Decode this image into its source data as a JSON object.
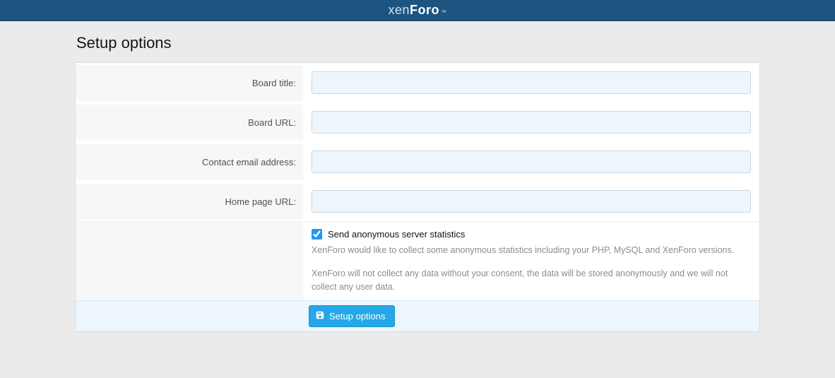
{
  "brand": {
    "part1": "xen",
    "part2": "Foro",
    "tm": "™"
  },
  "page": {
    "title": "Setup options"
  },
  "form": {
    "board_title": {
      "label": "Board title:",
      "value": ""
    },
    "board_url": {
      "label": "Board URL:",
      "value": ""
    },
    "contact_email": {
      "label": "Contact email address:",
      "value": ""
    },
    "home_page_url": {
      "label": "Home page URL:",
      "value": ""
    },
    "stats": {
      "checked": true,
      "label": "Send anonymous server statistics",
      "hint1": "XenForo would like to collect some anonymous statistics including your PHP, MySQL and XenForo versions.",
      "hint2": "XenForo will not collect any data without your consent, the data will be stored anonymously and we will not collect any user data."
    },
    "submit_label": "Setup options"
  }
}
